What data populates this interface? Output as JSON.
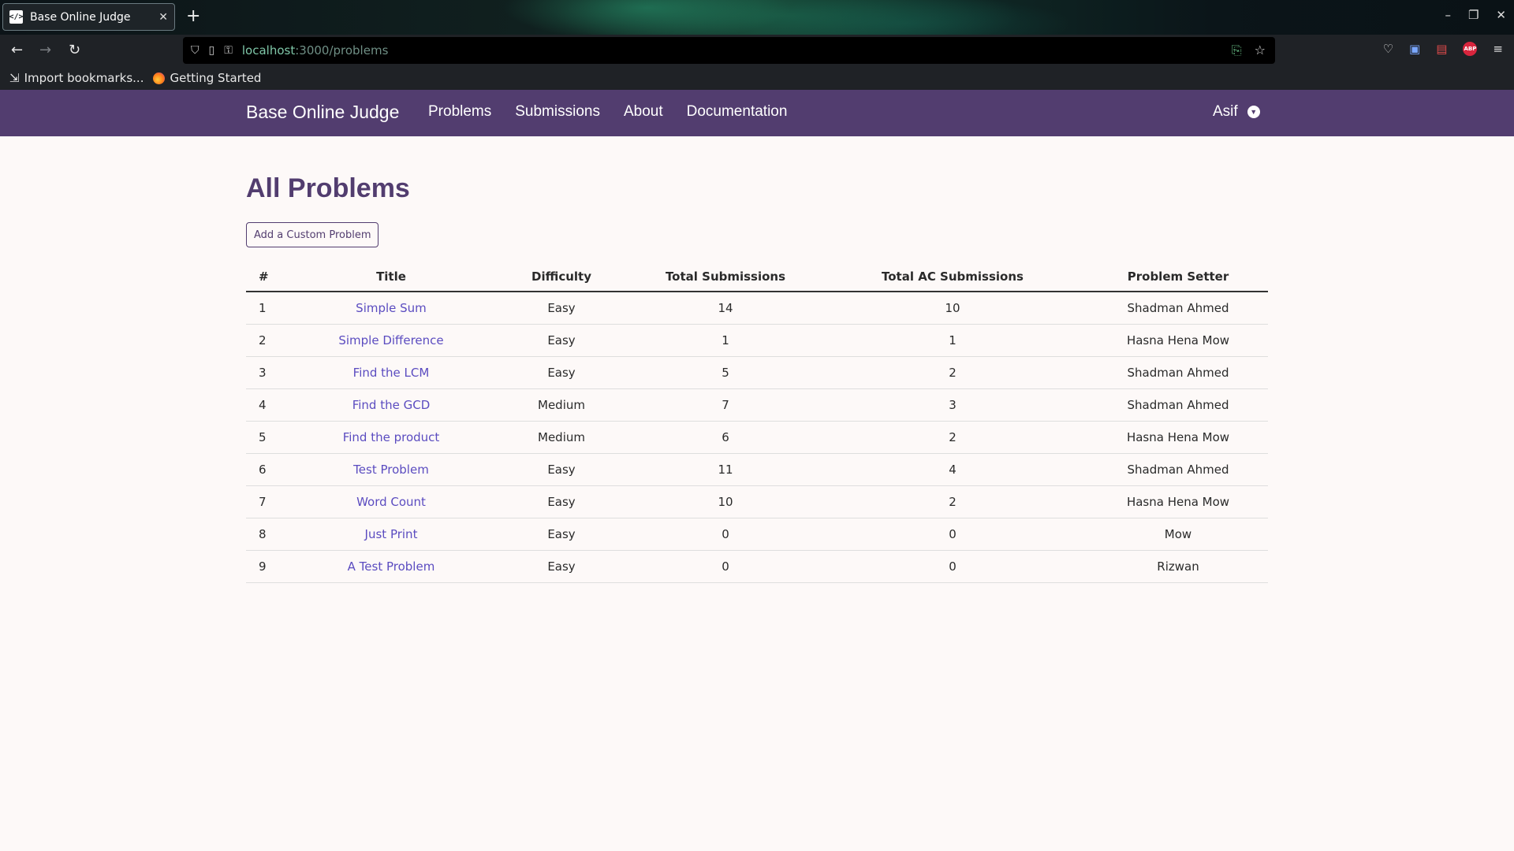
{
  "browser": {
    "tab_title": "Base Online Judge",
    "url_host": "localhost",
    "url_path": ":3000/problems",
    "bookmarks": [
      {
        "label": "Import bookmarks..."
      },
      {
        "label": "Getting Started"
      }
    ]
  },
  "app": {
    "brand": "Base Online Judge",
    "menu": [
      "Problems",
      "Submissions",
      "About",
      "Documentation"
    ],
    "user": "Asif"
  },
  "page": {
    "title": "All Problems",
    "add_button": "Add a Custom Problem"
  },
  "table": {
    "headers": [
      "#",
      "Title",
      "Difficulty",
      "Total Submissions",
      "Total AC Submissions",
      "Problem Setter"
    ],
    "rows": [
      [
        "1",
        "Simple Sum",
        "Easy",
        "14",
        "10",
        "Shadman Ahmed"
      ],
      [
        "2",
        "Simple Difference",
        "Easy",
        "1",
        "1",
        "Hasna Hena Mow"
      ],
      [
        "3",
        "Find the LCM",
        "Easy",
        "5",
        "2",
        "Shadman Ahmed"
      ],
      [
        "4",
        "Find the GCD",
        "Medium",
        "7",
        "3",
        "Shadman Ahmed"
      ],
      [
        "5",
        "Find the product",
        "Medium",
        "6",
        "2",
        "Hasna Hena Mow"
      ],
      [
        "6",
        "Test Problem",
        "Easy",
        "11",
        "4",
        "Shadman Ahmed"
      ],
      [
        "7",
        "Word Count",
        "Easy",
        "10",
        "2",
        "Hasna Hena Mow"
      ],
      [
        "8",
        "Just Print",
        "Easy",
        "0",
        "0",
        "Mow"
      ],
      [
        "9",
        "A Test Problem",
        "Easy",
        "0",
        "0",
        "Rizwan"
      ]
    ]
  },
  "colors": {
    "nav_bg": "#523d6f",
    "link": "#5b4cc0",
    "page_bg": "#fdf9f8"
  }
}
